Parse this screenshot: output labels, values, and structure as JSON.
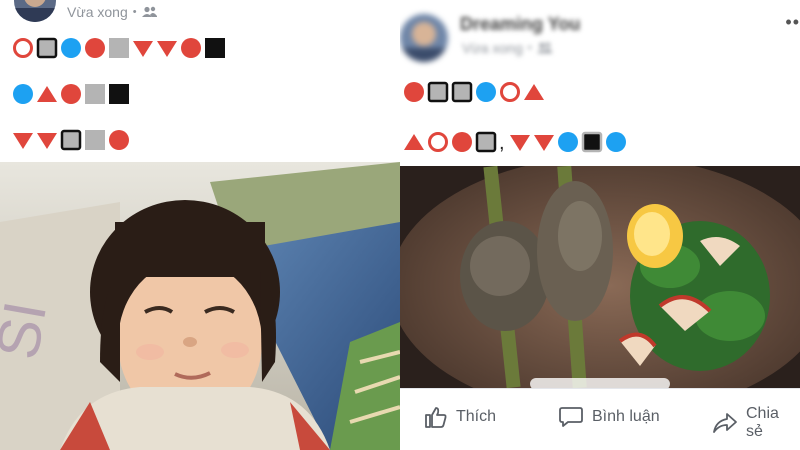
{
  "left_post": {
    "time_label": "Vừa xong",
    "separator": "•",
    "privacy_icon": "friends-icon",
    "rows": [
      [
        "circle-outline",
        "square-outline",
        "circle-blue",
        "circle-red",
        "square-gray",
        "triangle-down",
        "triangle-down",
        "circle-red",
        "square-black"
      ],
      [
        "circle-blue",
        "triangle-up",
        "circle-red",
        "square-gray",
        "square-black"
      ],
      [
        "triangle-down",
        "triangle-down",
        "square-outline",
        "square-gray",
        "circle-red"
      ]
    ]
  },
  "right_post": {
    "author_name": "Dreaming You",
    "time_label": "Vừa xong",
    "separator": "•",
    "more_label": "••",
    "rows": [
      [
        "circle-red",
        "square-outline",
        "square-outline",
        "circle-blue",
        "circle-outline",
        "triangle-up"
      ],
      [
        "triangle-up",
        "circle-outline",
        "circle-red",
        "square-outline",
        ",",
        "triangle-down",
        "triangle-down",
        "circle-blue",
        "square-outline-black",
        "circle-blue"
      ]
    ],
    "actions": {
      "like_label": "Thích",
      "comment_label": "Bình luận",
      "share_label": "Chia sẻ"
    }
  },
  "colors": {
    "red": "#e0463c",
    "blue": "#1da1f2",
    "gray": "#b4b4b4",
    "black": "#111111",
    "meta_text": "#8f949b"
  }
}
